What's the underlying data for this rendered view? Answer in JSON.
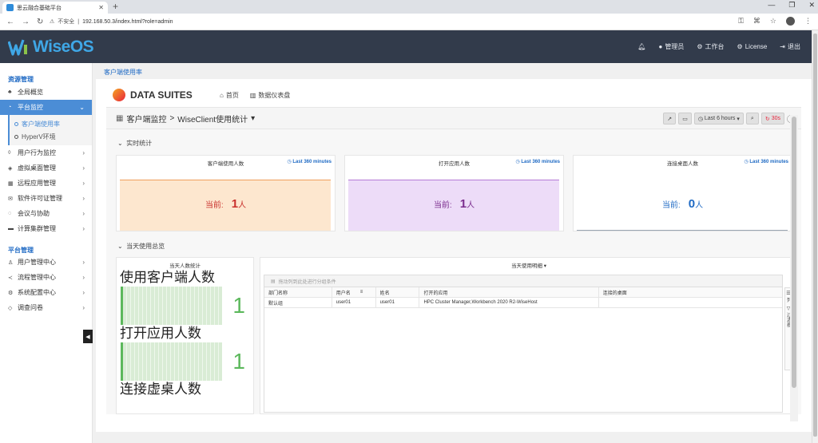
{
  "browser": {
    "tab_title": "思云融合基础平台",
    "insecure_label": "不安全",
    "url": "192.168.50.3/index.html?role=admin"
  },
  "header": {
    "logo_text": "WiseOS",
    "menu": [
      {
        "label": "管理员"
      },
      {
        "label": "工作台"
      },
      {
        "label": "License"
      },
      {
        "label": "退出"
      }
    ]
  },
  "sidebar": {
    "section1": "资源管理",
    "overview": "全局概览",
    "platform_monitor": "平台监控",
    "subs": [
      "客户端使用率",
      "HyperV环境"
    ],
    "items1": [
      "用户行为监控",
      "虚拟桌面管理",
      "远程应用管理",
      "软件许可证管理",
      "会议与协助",
      "计算集群管理"
    ],
    "section2": "平台管理",
    "items2": [
      "用户管理中心",
      "流程管理中心",
      "系统配置中心",
      "调查问卷"
    ]
  },
  "page": {
    "breadcrumb": "客户端使用率"
  },
  "dashboard": {
    "brand": "DATA SUITES",
    "nav_home": "首页",
    "nav_dash": "数据仪表盘",
    "path_root": "客户端监控",
    "path_sep": ">",
    "path_leaf": "WiseClient使用统计",
    "time_range": "Last 6 hours",
    "refresh": "30s",
    "row1": "实时统计",
    "row2": "当天使用总览",
    "stats": [
      {
        "title": "客户端使用人数",
        "range": "Last 360 minutes",
        "current_label": "当前:",
        "value": "1",
        "unit": "人",
        "color": "#c9302c",
        "fill": "#fde7cf",
        "line": "#f0a05c"
      },
      {
        "title": "打开应用人数",
        "range": "Last 360 minutes",
        "current_label": "当前:",
        "value": "1",
        "unit": "人",
        "color": "#7b2d8e",
        "fill": "#eddcf8",
        "line": "#b57ad6"
      },
      {
        "title": "连接桌面人数",
        "range": "Last 360 minutes",
        "current_label": "当前:",
        "value": "0",
        "unit": "人",
        "color": "#1f6ac4",
        "fill": "#ffffff",
        "line": "#9aa5b1"
      }
    ],
    "counts": {
      "title": "当天人数统计",
      "rows": [
        {
          "label": "使用客户端人数",
          "value": "1"
        },
        {
          "label": "打开应用人数",
          "value": "1"
        },
        {
          "label": "连接虚桌人数",
          "value": ""
        }
      ]
    },
    "detail": {
      "title": "当天使用明细",
      "group_hint": "拖动列到此处进行分组条件",
      "columns": [
        "部门名称",
        "用户名",
        "姓名",
        "打开的应用",
        "连接的桌面"
      ],
      "rows": [
        [
          "默认组",
          "user01",
          "user01",
          "HPC Cluster Manager,Workbench 2020 R2-WiseHost",
          ""
        ]
      ],
      "side_cols": "列",
      "side_filter": "过滤器"
    }
  }
}
